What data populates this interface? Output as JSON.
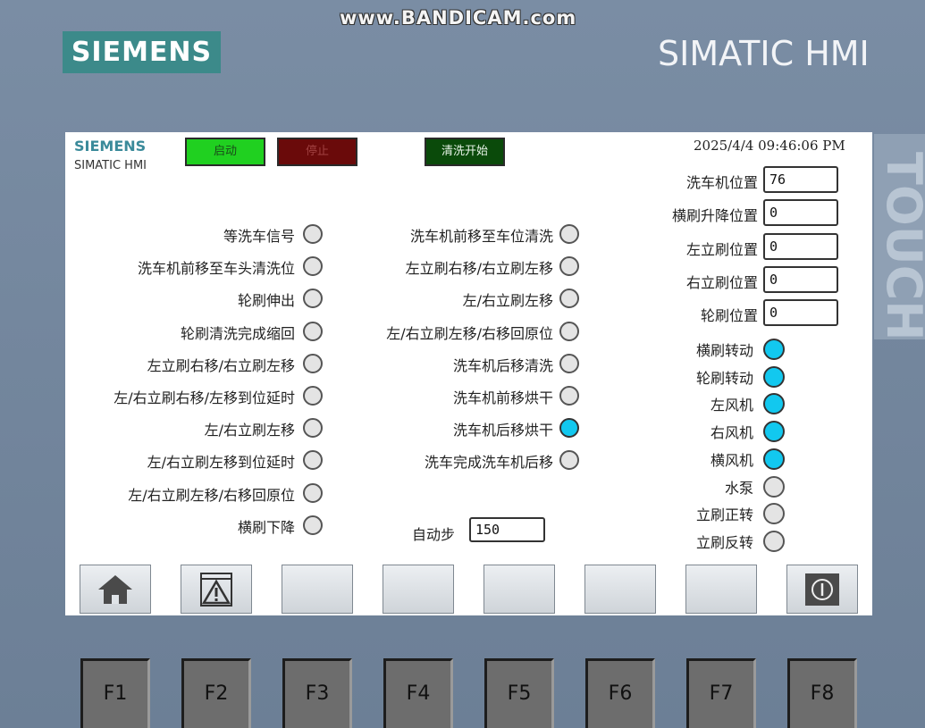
{
  "watermark": "www.BANDICAM.com",
  "device": {
    "brand": "SIEMENS",
    "title": "SIMATIC HMI",
    "touch_label": "TOUCH"
  },
  "screen": {
    "brand": "SIEMENS",
    "subtitle": "SIMATIC HMI",
    "buttons": {
      "start": "启动",
      "stop": "停止",
      "wash_start": "清洗开始"
    },
    "datetime": "2025/4/4 09:46:06 PM",
    "left_signals": [
      {
        "label": "等洗车信号",
        "on": false
      },
      {
        "label": "洗车机前移至车头清洗位",
        "on": false
      },
      {
        "label": "轮刷伸出",
        "on": false
      },
      {
        "label": "轮刷清洗完成缩回",
        "on": false
      },
      {
        "label": "左立刷右移/右立刷左移",
        "on": false
      },
      {
        "label": "左/右立刷右移/左移到位延时",
        "on": false
      },
      {
        "label": "左/右立刷左移",
        "on": false
      },
      {
        "label": "左/右立刷左移到位延时",
        "on": false
      },
      {
        "label": "左/右立刷左移/右移回原位",
        "on": false
      },
      {
        "label": "横刷下降",
        "on": false
      }
    ],
    "middle_signals": [
      {
        "label": "洗车机前移至车位清洗",
        "on": false
      },
      {
        "label": "左立刷右移/右立刷左移",
        "on": false
      },
      {
        "label": "左/右立刷左移",
        "on": false
      },
      {
        "label": "左/右立刷左移/右移回原位",
        "on": false
      },
      {
        "label": "洗车机后移清洗",
        "on": false
      },
      {
        "label": "洗车机前移烘干",
        "on": false
      },
      {
        "label": "洗车机后移烘干",
        "on": true
      },
      {
        "label": "洗车完成洗车机后移",
        "on": false
      }
    ],
    "auto_step": {
      "label": "自动步",
      "value": "150"
    },
    "positions": [
      {
        "label": "洗车机位置",
        "value": "76"
      },
      {
        "label": "横刷升降位置",
        "value": "0"
      },
      {
        "label": "左立刷位置",
        "value": "0"
      },
      {
        "label": "右立刷位置",
        "value": "0"
      },
      {
        "label": "轮刷位置",
        "value": "0"
      }
    ],
    "outputs": [
      {
        "label": "横刷转动",
        "on": true
      },
      {
        "label": "轮刷转动",
        "on": true
      },
      {
        "label": "左风机",
        "on": true
      },
      {
        "label": "右风机",
        "on": true
      },
      {
        "label": "横风机",
        "on": true
      },
      {
        "label": "水泵",
        "on": false
      },
      {
        "label": "立刷正转",
        "on": false
      },
      {
        "label": "立刷反转",
        "on": false
      }
    ],
    "nav_icons": [
      "home-icon",
      "alarm-warning-icon",
      "",
      "",
      "",
      "",
      "",
      "power-icon"
    ],
    "colors": {
      "lamp_on": "#12c8ef",
      "lamp_off": "#e4e4e4",
      "start": "#20d020",
      "stop": "#6a0a0a",
      "wash": "#0a4a0a"
    }
  },
  "function_keys": [
    "F1",
    "F2",
    "F3",
    "F4",
    "F5",
    "F6",
    "F7",
    "F8"
  ]
}
